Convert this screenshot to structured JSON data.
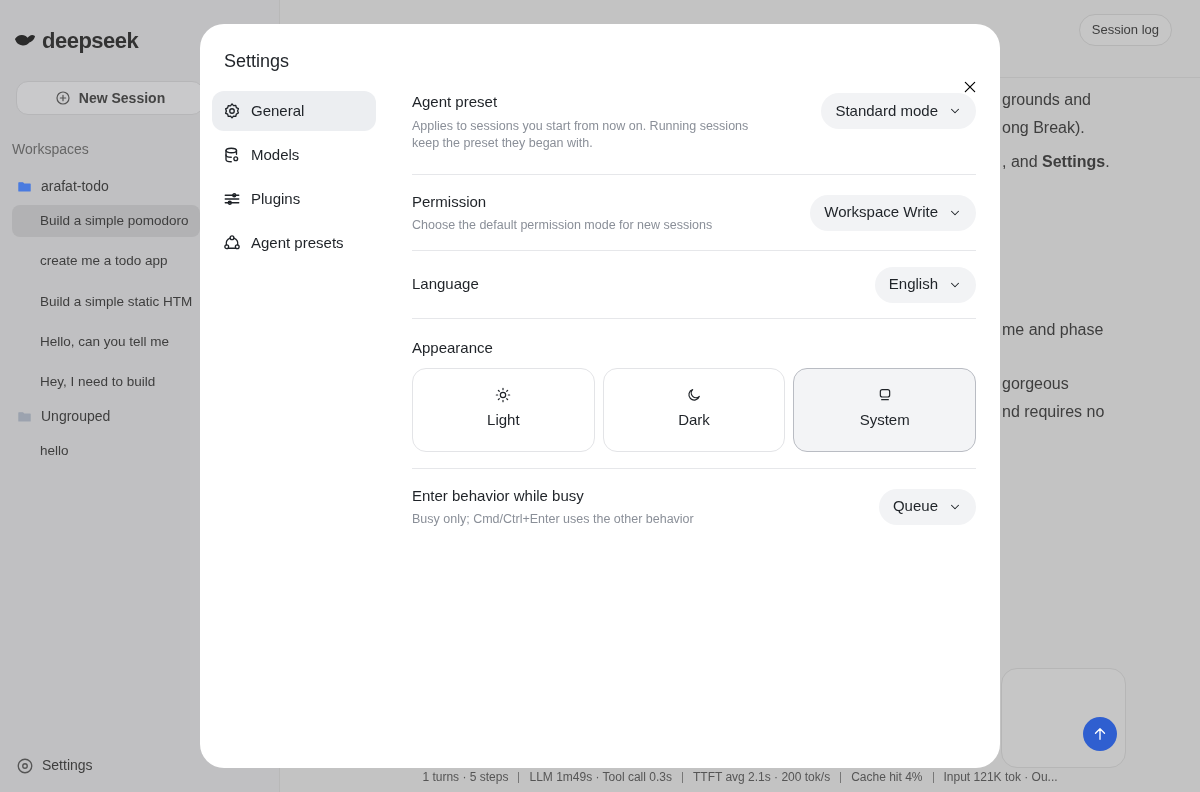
{
  "background": {
    "logo": "deepseek",
    "new_session": "New Session",
    "workspaces_label": "Workspaces",
    "groups": [
      {
        "name": "arafat-todo",
        "color": "#4a7be0",
        "children": [
          {
            "label": "Build a simple pomodoro",
            "selected": true
          },
          {
            "label": "create me a todo app",
            "selected": false
          },
          {
            "label": "Build a simple static HTM",
            "selected": false
          },
          {
            "label": "Hello, can you tell me",
            "selected": false
          },
          {
            "label": "Hey, I need to build",
            "selected": false
          }
        ]
      },
      {
        "name": "Ungrouped",
        "color": "#9ca3af",
        "children": [
          {
            "label": "hello",
            "selected": false
          }
        ]
      }
    ],
    "settings_link": "Settings",
    "session_log_button": "Session log",
    "message_paragraphs": [
      [
        "grounds and",
        "ong Break)."
      ],
      [
        ", and **Settings**."
      ],
      [
        "me and phase"
      ],
      [
        "gorgeous",
        "nd requires no"
      ]
    ],
    "status_bar": [
      "1 turns · 5 steps",
      "LLM 1m49s · Tool call 0.3s",
      "TTFT avg 2.1s · 200 tok/s",
      "Cache hit 4%",
      "Input 121K tok · Ou..."
    ]
  },
  "settings": {
    "title": "Settings",
    "nav": [
      {
        "label": "General",
        "selected": true
      },
      {
        "label": "Models",
        "selected": false
      },
      {
        "label": "Plugins",
        "selected": false
      },
      {
        "label": "Agent presets",
        "selected": false
      }
    ],
    "rows": [
      {
        "kind": "select",
        "label": "Agent preset",
        "description": "Applies to sessions you start from now on. Running sessions keep the preset they began with.",
        "value": "Standard mode"
      },
      {
        "kind": "select",
        "label": "Permission",
        "description": "Choose the default permission mode for new sessions",
        "value": "Workspace Write"
      },
      {
        "kind": "select",
        "label": "Language",
        "value": "English"
      },
      {
        "kind": "appearance",
        "label": "Appearance",
        "options": [
          {
            "label": "Light",
            "selected": false
          },
          {
            "label": "Dark",
            "selected": false
          },
          {
            "label": "System",
            "selected": true
          }
        ]
      },
      {
        "kind": "select",
        "label": "Enter behavior while busy",
        "description": "Busy only; Cmd/Ctrl+Enter uses the other behavior",
        "value": "Queue"
      }
    ]
  }
}
